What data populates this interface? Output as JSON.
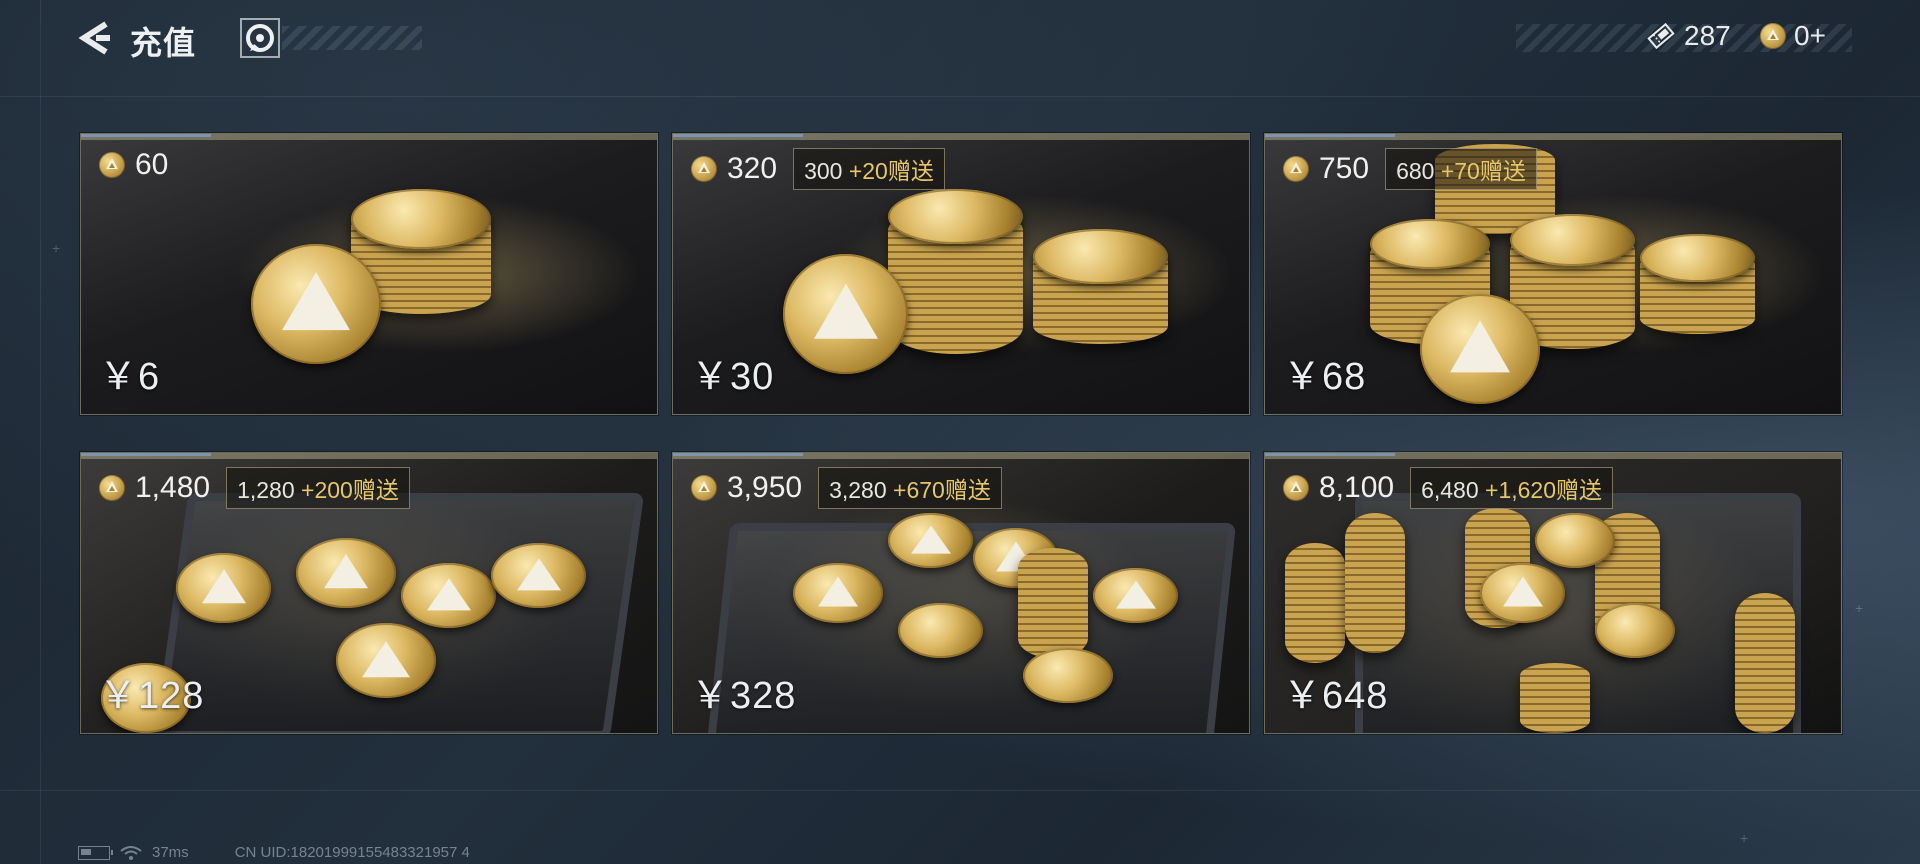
{
  "header": {
    "title": "充值",
    "ticket_count": "287",
    "coin_count": "0+"
  },
  "packages": [
    {
      "amount": "60",
      "bonus_base": "",
      "bonus_add": "",
      "price": "￥6"
    },
    {
      "amount": "320",
      "bonus_base": "300 ",
      "bonus_add": "+20赠送",
      "price": "￥30"
    },
    {
      "amount": "750",
      "bonus_base": "680 ",
      "bonus_add": "+70赠送",
      "price": "￥68"
    },
    {
      "amount": "1,480",
      "bonus_base": "1,280 ",
      "bonus_add": "+200赠送",
      "price": "￥128"
    },
    {
      "amount": "3,950",
      "bonus_base": "3,280 ",
      "bonus_add": "+670赠送",
      "price": "￥328"
    },
    {
      "amount": "8,100",
      "bonus_base": "6,480 ",
      "bonus_add": "+1,620赠送",
      "price": "￥648"
    }
  ],
  "footer": {
    "ping": "37ms",
    "uid": "CN UID:18201999155483321957 4"
  },
  "icons": {
    "back": "back-arrow-icon",
    "support": "support-icon",
    "ticket": "ticket-icon",
    "coin": "coin-icon",
    "battery": "battery-icon",
    "wifi": "wifi-icon"
  }
}
